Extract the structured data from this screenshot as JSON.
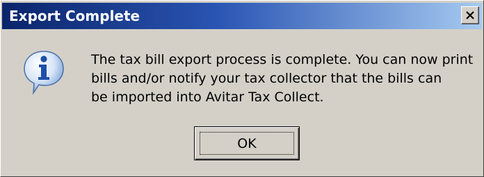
{
  "window": {
    "title": "Export Complete",
    "close_icon": "close-icon",
    "titlebar_colors": [
      "#0a246a",
      "#a6caf0"
    ],
    "background": "#d4d0c8"
  },
  "message": {
    "icon": "info-icon",
    "lines": [
      "The tax bill export process is complete.  You can now print",
      "bills and/or notify your tax collector that the bills can",
      "be imported into Avitar Tax Collect."
    ]
  },
  "buttons": {
    "ok_label": "OK"
  }
}
